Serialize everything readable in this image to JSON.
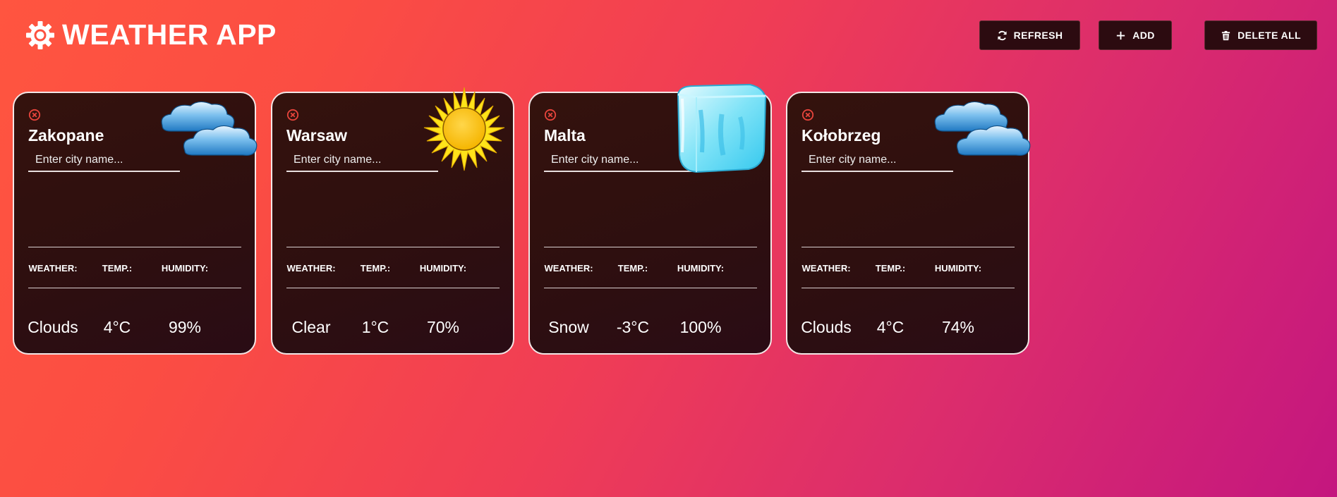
{
  "app": {
    "title": "WEATHER APP",
    "logo_icon": "gear-icon"
  },
  "toolbar": {
    "refresh_label": "REFRESH",
    "refresh_icon": "refresh-icon",
    "add_label": "ADD",
    "add_icon": "plus-icon",
    "delete_all_label": "DELETE ALL",
    "delete_all_icon": "trash-icon"
  },
  "colors": {
    "background_start": "#ff5540",
    "background_end": "#c4167f",
    "card_background": "#2e0f0f",
    "remove_icon": "#e8453c"
  },
  "cards": [
    {
      "city": "Zakopane",
      "placeholder": "Enter city name...",
      "weather_label": "WEATHER:",
      "temp_label": "TEMP.:",
      "humidity_label": "HUMIDITY:",
      "weather": "Clouds",
      "temp": "4°C",
      "humidity": "99%",
      "icon": "clouds-icon"
    },
    {
      "city": "Warsaw",
      "placeholder": "Enter city name...",
      "weather_label": "WEATHER:",
      "temp_label": "TEMP.:",
      "humidity_label": "HUMIDITY:",
      "weather": "Clear",
      "temp": "1°C",
      "humidity": "70%",
      "icon": "sun-icon"
    },
    {
      "city": "Malta",
      "placeholder": "Enter city name...",
      "weather_label": "WEATHER:",
      "temp_label": "TEMP.:",
      "humidity_label": "HUMIDITY:",
      "weather": "Snow",
      "temp": "-3°C",
      "humidity": "100%",
      "icon": "ice-cube-icon"
    },
    {
      "city": "Kołobrzeg",
      "placeholder": "Enter city name...",
      "weather_label": "WEATHER:",
      "temp_label": "TEMP.:",
      "humidity_label": "HUMIDITY:",
      "weather": "Clouds",
      "temp": "4°C",
      "humidity": "74%",
      "icon": "clouds-icon"
    }
  ]
}
